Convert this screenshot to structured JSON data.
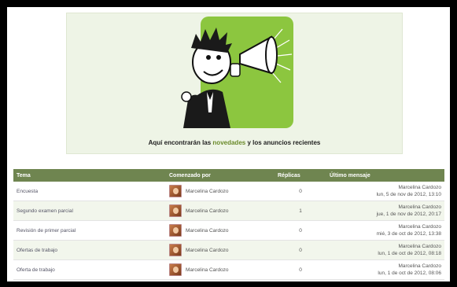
{
  "banner": {
    "text_before": "Aquí encontrarán las ",
    "highlight": "novedades",
    "text_after": " y los anuncios recientes",
    "colors": {
      "background": "#eef4e6",
      "megaphone_bg": "#8cc63f",
      "highlight": "#6a8a2a"
    }
  },
  "table": {
    "headers": {
      "topic": "Tema",
      "started_by": "Comenzado por",
      "replies": "Réplicas",
      "last_post": "Último mensaje"
    },
    "header_color": "#6f8550",
    "rows": [
      {
        "topic": "Encuesta",
        "started_by": "Marcelina Cardozo",
        "replies": "0",
        "last_author": "Marcelina Cardozo",
        "last_date": "lun, 5 de nov de 2012, 13:10"
      },
      {
        "topic": "Segundo examen parcial",
        "started_by": "Marcelina Cardozo",
        "replies": "1",
        "last_author": "Marcelina Cardozo",
        "last_date": "jue, 1 de nov de 2012, 20:17"
      },
      {
        "topic": "Revisión de primer parcial",
        "started_by": "Marcelina Cardozo",
        "replies": "0",
        "last_author": "Marcelina Cardozo",
        "last_date": "mié, 3 de oct de 2012, 13:38"
      },
      {
        "topic": "Ofertas de trabajo",
        "started_by": "Marcelina Cardozo",
        "replies": "0",
        "last_author": "Marcelina Cardozo",
        "last_date": "lun, 1 de oct de 2012, 08:18"
      },
      {
        "topic": "Oferta de trabajo",
        "started_by": "Marcelina Cardozo",
        "replies": "0",
        "last_author": "Marcelina Cardozo",
        "last_date": "lun, 1 de oct de 2012, 08:06"
      }
    ]
  }
}
